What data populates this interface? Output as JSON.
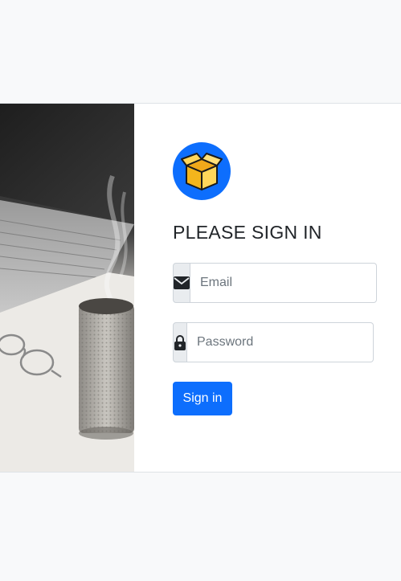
{
  "login": {
    "title": "PLEASE SIGN IN",
    "email_placeholder": "Email",
    "password_placeholder": "Password",
    "submit_label": "Sign in"
  },
  "icons": {
    "logo": "open-box-icon",
    "email": "envelope-icon",
    "password": "lock-icon"
  },
  "colors": {
    "accent": "#0d6efd",
    "page_background": "#f8f9fa",
    "addon_background": "#e9ecef",
    "title_text": "#212529"
  }
}
